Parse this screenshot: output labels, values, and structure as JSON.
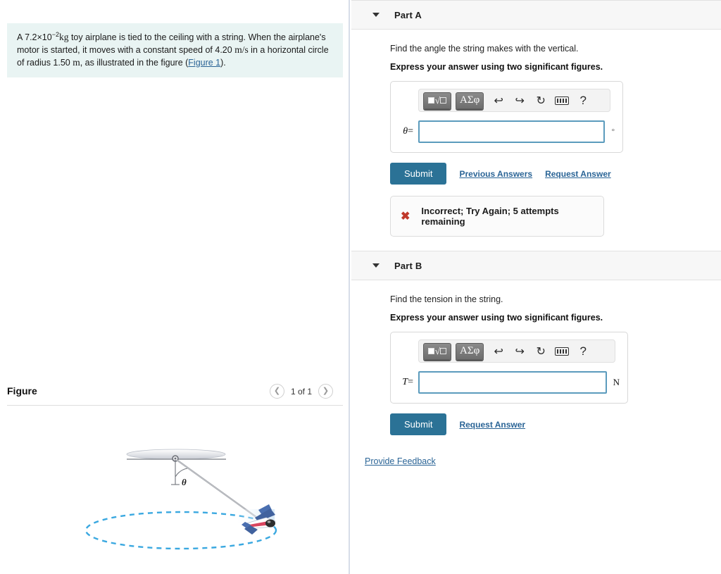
{
  "problem": {
    "text_lead": "A ",
    "mass_value": "7.2×10",
    "mass_exp": "−2",
    "mass_unit": "kg",
    "text_part1": " toy airplane is tied to the ceiling with a string. When the airplane's motor is started, it moves with a constant speed of 4.20 ",
    "speed_unit": "m/s",
    "text_part2": " in a horizontal circle of radius 1.50 ",
    "radius_unit": "m",
    "text_part3": ", as illustrated in the figure (",
    "figure_link": "Figure 1",
    "text_part4": ")."
  },
  "figure": {
    "title": "Figure",
    "pager": {
      "prev_icon": "chevron-left-icon",
      "count_label": "1 of 1",
      "next_icon": "chevron-right-icon"
    },
    "angle_symbol": "θ"
  },
  "parts": [
    {
      "id": "A",
      "label": "Part A",
      "caret_icon": "caret-down-icon",
      "prompt": "Find the angle the string makes with the vertical.",
      "express": "Express your answer using two significant figures.",
      "toolbar": {
        "sqrt_label": "sqrt-template-button",
        "greek_label": "ΑΣφ",
        "undo_icon": "undo-arrow-icon",
        "redo_icon": "redo-arrow-icon",
        "reset_icon": "reset-circular-arrow-icon",
        "keyboard_icon": "keyboard-icon",
        "help_label": "?"
      },
      "field": {
        "symbol": "θ",
        "equals": "=",
        "value": "",
        "placeholder": "",
        "unit": "°"
      },
      "submit_label": "Submit",
      "links": [
        "Previous Answers",
        "Request Answer"
      ],
      "feedback": {
        "icon": "x-mark-icon",
        "text": "Incorrect; Try Again; 5 attempts remaining",
        "color": "#c0392b"
      }
    },
    {
      "id": "B",
      "label": "Part B",
      "caret_icon": "caret-down-icon",
      "prompt": "Find the tension in the string.",
      "express": "Express your answer using two significant figures.",
      "toolbar": {
        "sqrt_label": "sqrt-template-button",
        "greek_label": "ΑΣφ",
        "undo_icon": "undo-arrow-icon",
        "redo_icon": "redo-arrow-icon",
        "reset_icon": "reset-circular-arrow-icon",
        "keyboard_icon": "keyboard-icon",
        "help_label": "?"
      },
      "field": {
        "symbol": "T",
        "equals": "=",
        "value": "",
        "placeholder": "",
        "unit": "N"
      },
      "submit_label": "Submit",
      "links": [
        "Request Answer"
      ],
      "feedback": null
    }
  ],
  "footer": {
    "provide_feedback": "Provide Feedback"
  },
  "colors": {
    "submit": "#2b7296",
    "link": "#2a6496",
    "problem_bg": "#e9f4f3",
    "error": "#c0392b",
    "input_border": "#5b9bbd",
    "circle_path": "#3aa8e0"
  }
}
